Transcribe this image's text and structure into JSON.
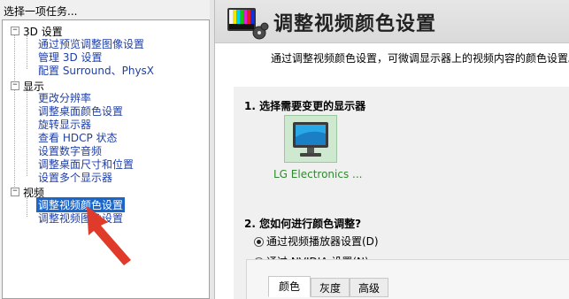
{
  "left_pane": {
    "header": "选择一项任务...",
    "categories": [
      {
        "label": "3D 设置",
        "toggle": "−",
        "items": [
          "通过预览调整图像设置",
          "管理 3D 设置",
          "配置 Surround、PhysX"
        ]
      },
      {
        "label": "显示",
        "toggle": "−",
        "items": [
          "更改分辨率",
          "调整桌面颜色设置",
          "旋转显示器",
          "查看 HDCP 状态",
          "设置数字音频",
          "调整桌面尺寸和位置",
          "设置多个显示器"
        ]
      },
      {
        "label": "视频",
        "toggle": "−",
        "items": [
          "调整视频颜色设置",
          "调整视频图像设置"
        ]
      }
    ],
    "selected_item": "调整视频颜色设置"
  },
  "right_pane": {
    "title": "调整视频颜色设置",
    "description": "通过调整视频颜色设置，可微调显示器上的视频内容的颜色设置。允",
    "section1_title": "1. 选择需要变更的显示器",
    "monitor_label": "LG Electronics ...",
    "section2_title": "2. 您如何进行颜色调整?",
    "radio_options": [
      {
        "label": "通过视频播放器设置(D)",
        "checked": true
      },
      {
        "label": "通过 NVIDIA 设置(N)",
        "checked": false
      }
    ],
    "tabs": [
      {
        "label": "颜色",
        "active": true
      },
      {
        "label": "灰度",
        "active": false
      },
      {
        "label": "高级",
        "active": false
      }
    ]
  },
  "colors": {
    "selection_bg": "#1c66c8",
    "link_text": "#1f3fa8",
    "monitor_label": "#2f8a2f",
    "annotation_arrow": "#e03a2a"
  },
  "icons": [
    "color-bars-icon",
    "monitor-icon",
    "annotation-arrow"
  ]
}
